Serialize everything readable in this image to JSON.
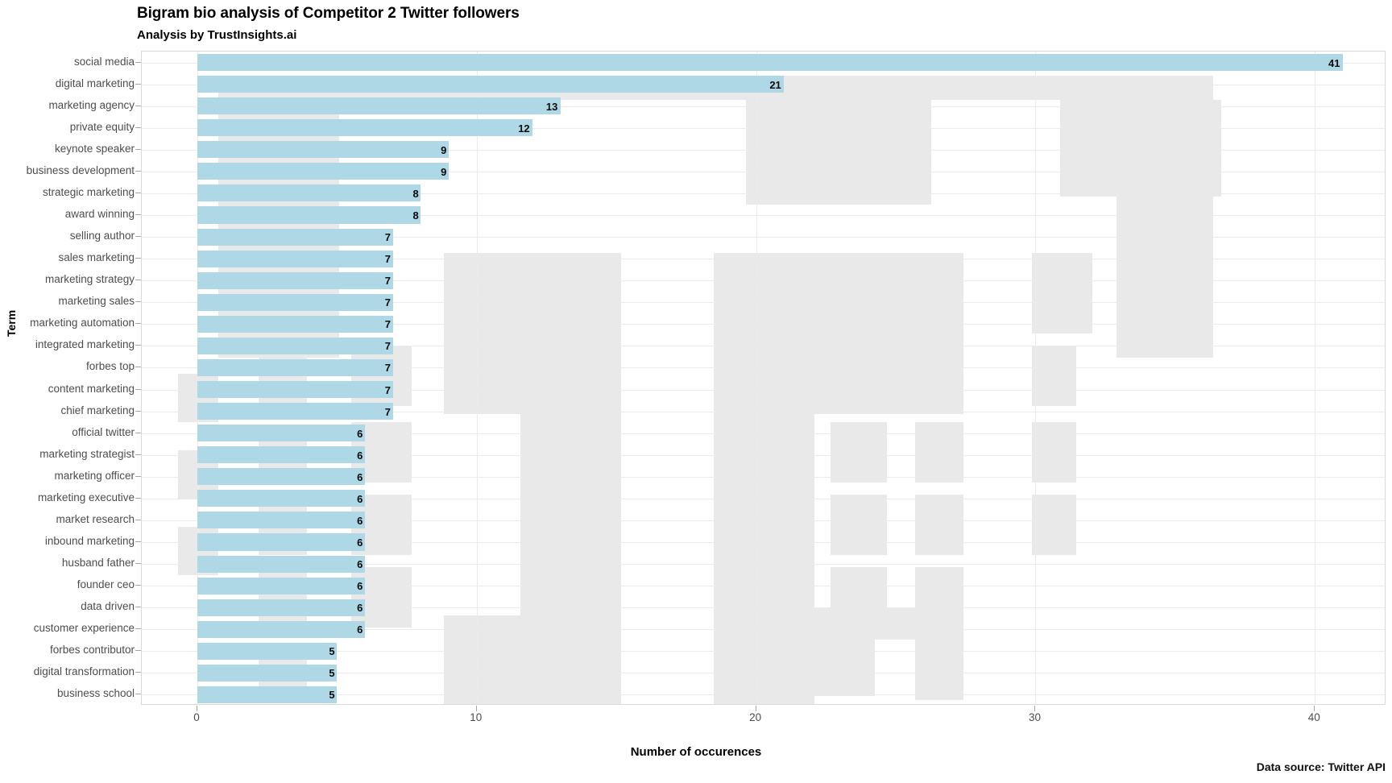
{
  "header": {
    "title": "Bigram bio analysis of Competitor 2 Twitter followers",
    "subtitle": "Analysis by TrustInsights.ai"
  },
  "footer": {
    "data_source": "Data source: Twitter API"
  },
  "colors": {
    "bar": "#aed8e6",
    "panel_background": "#ffffff",
    "grid": "#ebebeb",
    "watermark": "#e9e9e9",
    "tick_label": "#4d4d4d",
    "value_label": "#0a0a0a"
  },
  "chart_data": {
    "type": "bar",
    "orientation": "horizontal",
    "title": "Bigram bio analysis of Competitor 2 Twitter followers",
    "subtitle": "Analysis by TrustInsights.ai",
    "xlabel": "Number of occurences",
    "ylabel": "Term",
    "xlim": [
      0,
      42.5
    ],
    "xticks": [
      0,
      10,
      20,
      30,
      40
    ],
    "xtick_labels": [
      "0",
      "10",
      "20",
      "30",
      "40"
    ],
    "grid": true,
    "legend": false,
    "value_labels": true,
    "categories": [
      "social media",
      "digital marketing",
      "marketing agency",
      "private equity",
      "keynote speaker",
      "business development",
      "strategic marketing",
      "award winning",
      "selling author",
      "sales marketing",
      "marketing strategy",
      "marketing sales",
      "marketing automation",
      "integrated marketing",
      "forbes top",
      "content marketing",
      "chief marketing",
      "official twitter",
      "marketing strategist",
      "marketing officer",
      "marketing executive",
      "market research",
      "inbound marketing",
      "husband father",
      "founder ceo",
      "data driven",
      "customer experience",
      "forbes contributor",
      "digital transformation",
      "business school"
    ],
    "values": [
      41,
      21,
      13,
      12,
      9,
      9,
      8,
      8,
      7,
      7,
      7,
      7,
      7,
      7,
      7,
      7,
      7,
      6,
      6,
      6,
      6,
      6,
      6,
      6,
      6,
      6,
      6,
      5,
      5,
      5
    ]
  }
}
